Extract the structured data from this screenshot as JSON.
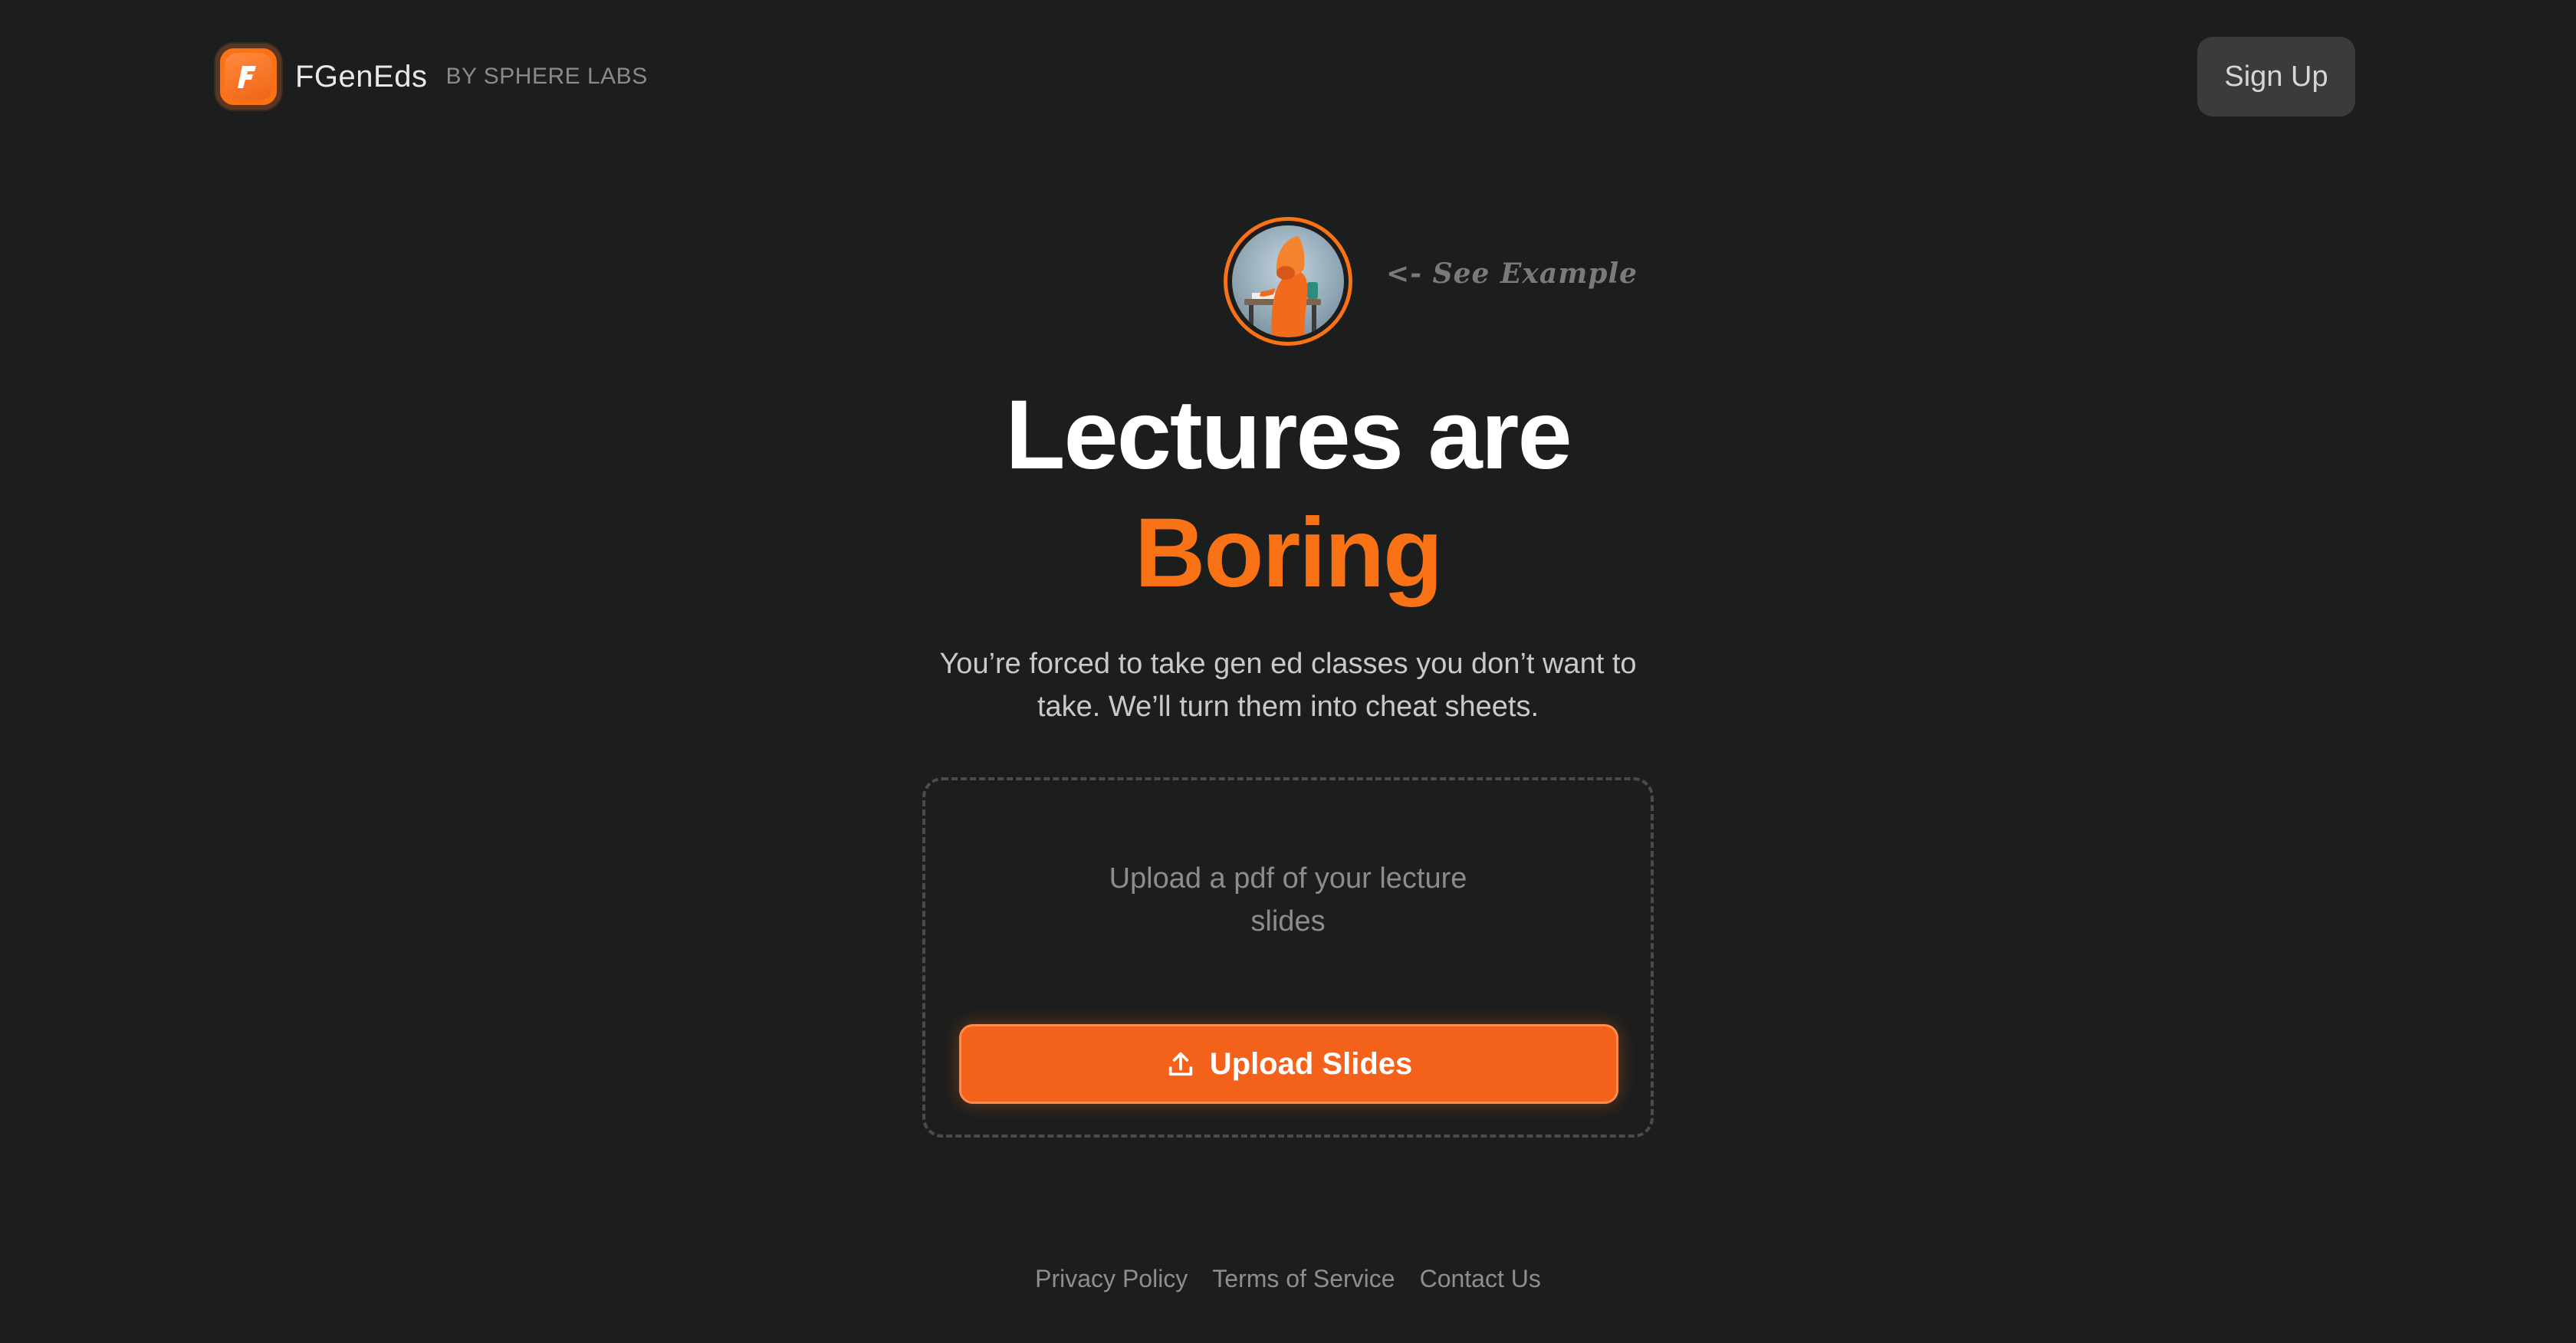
{
  "header": {
    "brand_name": "FGenEds",
    "brand_by": "BY SPHERE LABS",
    "logo_letter": "F",
    "signup_label": "Sign Up"
  },
  "example": {
    "label": "<- See Example",
    "avatar_icon": "mascot-avatar-icon"
  },
  "hero": {
    "headline_line1": "Lectures are",
    "headline_line2": "Boring",
    "subtitle": "You’re forced to take gen ed classes you don’t want to take. We’ll turn them into cheat sheets."
  },
  "upload": {
    "hint": "Upload a pdf of your lecture slides",
    "button_label": "Upload Slides",
    "button_icon": "upload-icon"
  },
  "footer": {
    "links": [
      "Privacy Policy",
      "Terms of Service",
      "Contact Us"
    ]
  },
  "colors": {
    "background": "#1c1d1d",
    "accent": "#f97316",
    "button": "#f4611b",
    "signup_bg": "#3a3b3c"
  }
}
